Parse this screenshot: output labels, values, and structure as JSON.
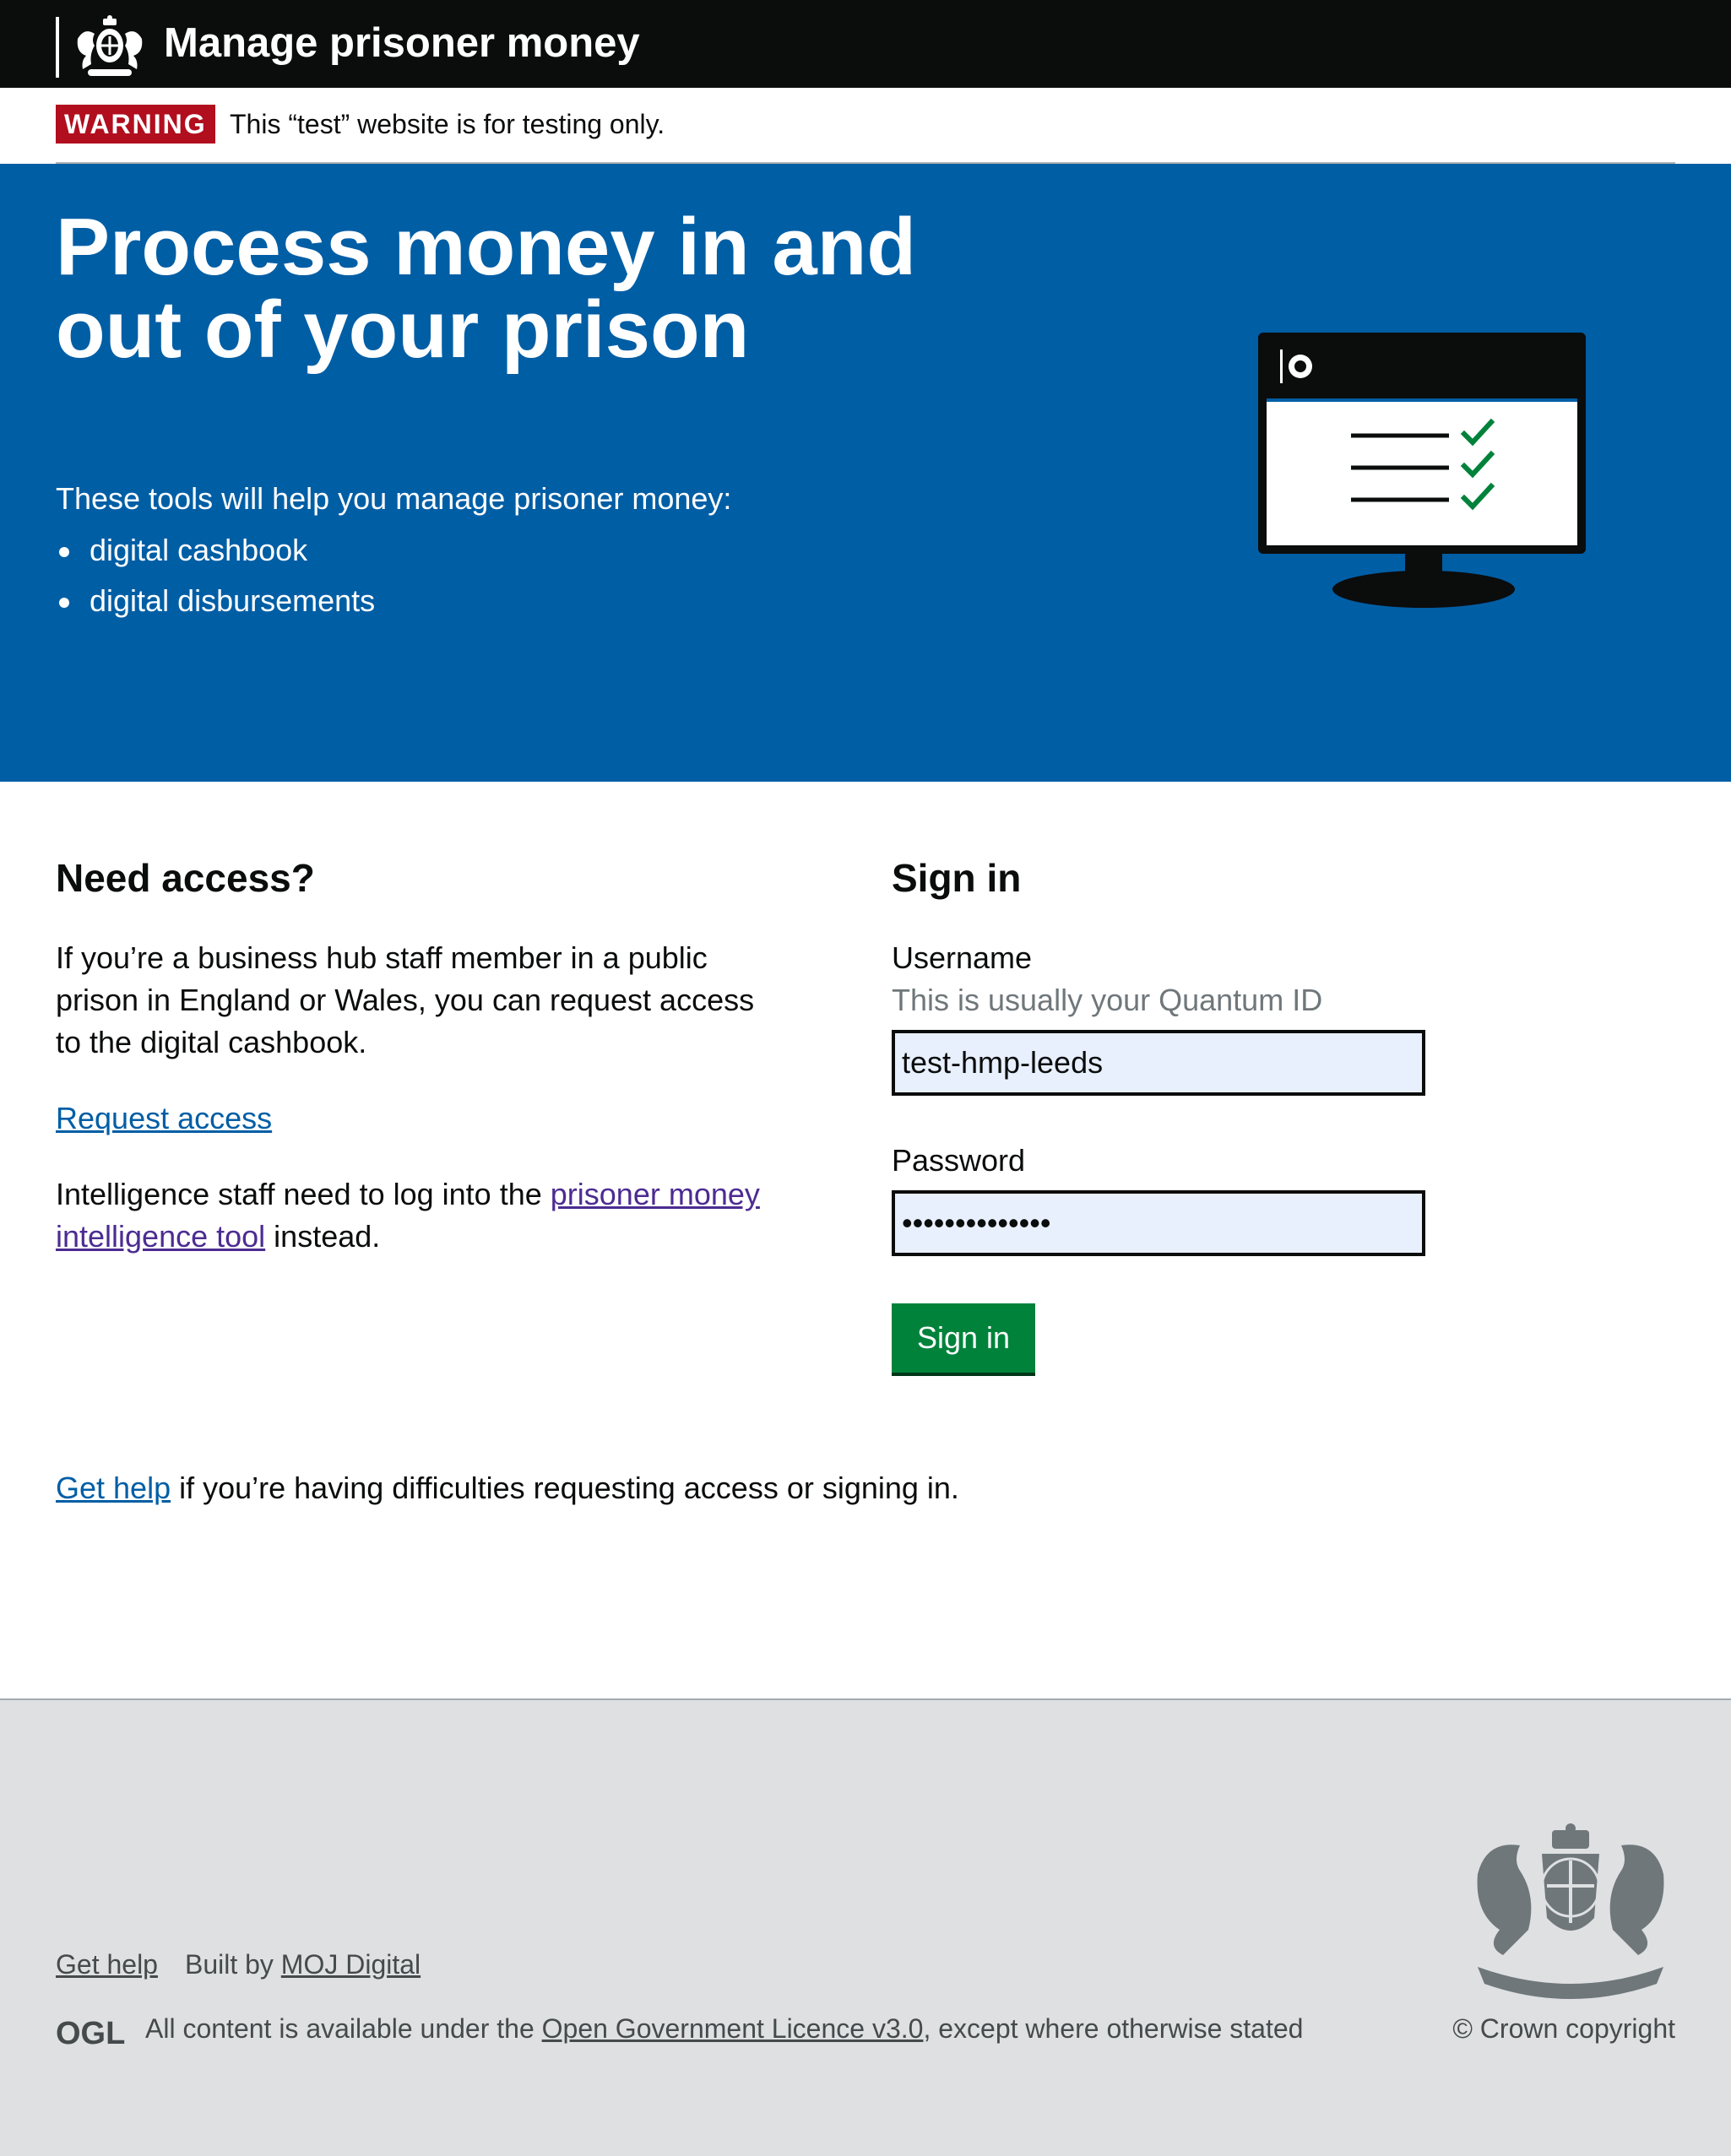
{
  "header": {
    "service_name": "Manage prisoner money",
    "logo_icon": "royal-crest-icon"
  },
  "warning": {
    "tag": "WARNING",
    "message": "This “test” website is for testing only."
  },
  "hero": {
    "title": "Process money in and out of your prison",
    "intro": "These tools will help you manage prisoner money:",
    "items": [
      "digital cashbook",
      "digital disbursements"
    ],
    "illustration_icon": "monitor-checklist-icon"
  },
  "access": {
    "heading": "Need access?",
    "body": "If you’re a business hub staff member in a public prison in England or Wales, you can request access to the digital cashbook.",
    "request_link": "Request access",
    "intel_before": "Intelligence staff need to log into the ",
    "intel_link": "prisoner money intelligence tool",
    "intel_after": " instead."
  },
  "signin": {
    "heading": "Sign in",
    "username_label": "Username",
    "username_hint": "This is usually your Quantum ID",
    "username_value": "test-hmp-leeds",
    "password_label": "Password",
    "password_value": "••••••••••••••",
    "button": "Sign in"
  },
  "help": {
    "link": "Get help",
    "text": " if you’re having difficulties requesting access or signing in."
  },
  "footer": {
    "help_link": "Get help",
    "built_by_prefix": "Built by ",
    "built_by_link": "MOJ Digital",
    "ogl_logo": "OGL",
    "licence_prefix": "All content is available under the ",
    "licence_link": "Open Government Licence v3.0",
    "licence_suffix": ", except where otherwise stated",
    "copyright": "© Crown copyright",
    "crest_icon": "royal-coat-of-arms-icon"
  },
  "colors": {
    "header_bg": "#0b0c0c",
    "hero_bg": "#005ea5",
    "warning_tag": "#b10e1e",
    "button_green": "#00823b",
    "link_blue": "#005ea5",
    "link_visited": "#4c2c92",
    "footer_bg": "#dee0e2"
  }
}
